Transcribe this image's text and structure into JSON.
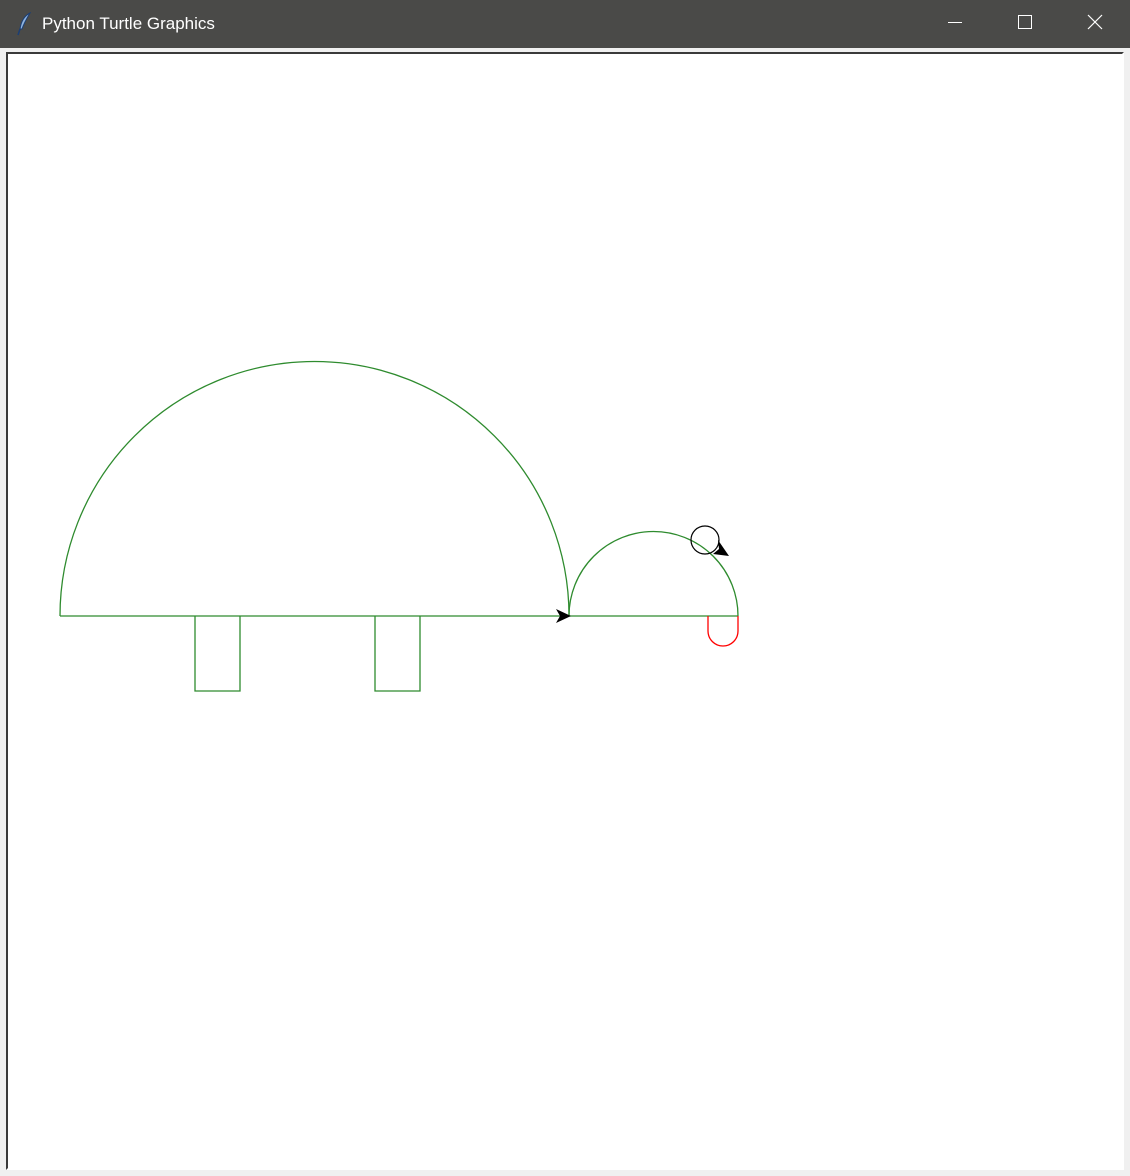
{
  "window": {
    "title": "Python Turtle Graphics",
    "app_icon": "feather-icon",
    "controls": {
      "minimize_icon": "minimize-icon",
      "maximize_icon": "maximize-icon",
      "close_icon": "close-icon"
    }
  },
  "canvas": {
    "background": "#ffffff",
    "drawing": {
      "body_color": "#2e8b2e",
      "mouth_color": "#ff0000",
      "eye_color": "#000000",
      "turtle_cursor_color": "#000000"
    }
  },
  "colors": {
    "titlebar": "#4a4a48",
    "title_text": "#ffffff"
  }
}
